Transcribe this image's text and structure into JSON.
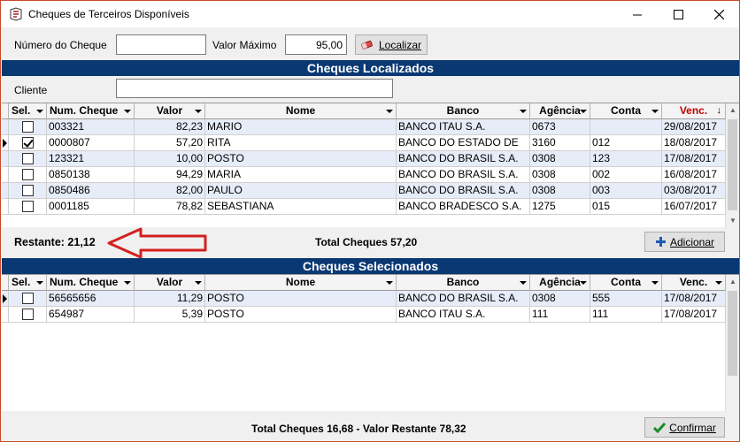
{
  "window": {
    "title": "Cheques de Terceiros Disponíveis"
  },
  "search": {
    "numero_label": "Número do Cheque",
    "numero_value": "",
    "valor_label": "Valor Máximo",
    "valor_value": "95,00",
    "localizar_label": "Localizar"
  },
  "localizados": {
    "title": "Cheques Localizados",
    "cliente_label": "Cliente",
    "cliente_value": "",
    "columns": [
      "Sel.",
      "Num. Cheque",
      "Valor",
      "Nome",
      "Banco",
      "Agência",
      "Conta",
      "Venc."
    ],
    "rows": [
      {
        "sel": false,
        "num": "003321",
        "valor": "82,23",
        "nome": "MARIO",
        "banco": "BANCO ITAU S.A.",
        "agencia": "0673",
        "conta": "",
        "venc": "29/08/2017"
      },
      {
        "sel": true,
        "num": "0000807",
        "valor": "57,20",
        "nome": "RITA",
        "banco": "BANCO DO ESTADO DE",
        "agencia": "3160",
        "conta": "012",
        "venc": "18/08/2017"
      },
      {
        "sel": false,
        "num": "123321",
        "valor": "10,00",
        "nome": "POSTO",
        "banco": "BANCO DO BRASIL S.A.",
        "agencia": "0308",
        "conta": "123",
        "venc": "17/08/2017"
      },
      {
        "sel": false,
        "num": "0850138",
        "valor": "94,29",
        "nome": "MARIA",
        "banco": "BANCO DO BRASIL S.A.",
        "agencia": "0308",
        "conta": "002",
        "venc": "16/08/2017"
      },
      {
        "sel": false,
        "num": "0850486",
        "valor": "82,00",
        "nome": "PAULO",
        "banco": "BANCO DO BRASIL S.A.",
        "agencia": "0308",
        "conta": "003",
        "venc": "03/08/2017"
      },
      {
        "sel": false,
        "num": "0001185",
        "valor": "78,82",
        "nome": "SEBASTIANA",
        "banco": "BANCO BRADESCO S.A.",
        "agencia": "1275",
        "conta": "015",
        "venc": "16/07/2017"
      }
    ],
    "restante": "Restante: 21,12",
    "total": "Total Cheques 57,20",
    "adicionar_label": "Adicionar"
  },
  "selecionados": {
    "title": "Cheques Selecionados",
    "columns": [
      "Sel.",
      "Num. Cheque",
      "Valor",
      "Nome",
      "Banco",
      "Agência",
      "Conta",
      "Venc."
    ],
    "rows": [
      {
        "sel": false,
        "num": "56565656",
        "valor": "11,29",
        "nome": "POSTO",
        "banco": "BANCO DO BRASIL S.A.",
        "agencia": "0308",
        "conta": "555",
        "venc": "17/08/2017"
      },
      {
        "sel": false,
        "num": "654987",
        "valor": "5,39",
        "nome": "POSTO",
        "banco": "BANCO ITAU S.A.",
        "agencia": "111",
        "conta": "111",
        "venc": "17/08/2017"
      }
    ],
    "total": "Total Cheques 16,68 - Valor Restante 78,32",
    "confirmar_label": "Confirmar"
  },
  "colors": {
    "section_bg": "#0a3873",
    "venc_header": "#c00000",
    "arrow": "#d42020",
    "row_alt": "#e6ecf8"
  }
}
